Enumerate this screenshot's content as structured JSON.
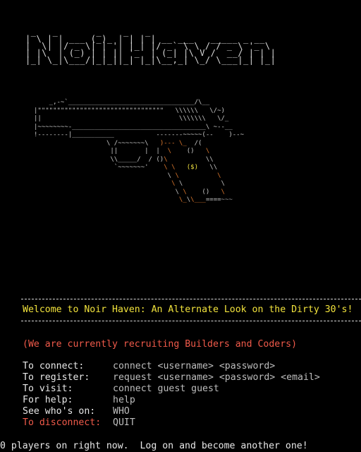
{
  "logo_ascii": " _   _        _____    _    _\n| \\ | |      / ___ \\  | |  | |\n|  \\| | ___ | |   | | | |__| | __ ___   _____ _ __\n| . ` |/ _ \\| |   | | |  __  |/ _` \\ \\ / / _ \\ '_ \\\n| |\\  | (_) | |___| | | |  | | (_| |\\ V /  __/ | | |\n|_| \\_|\\___/ \\_____/  |_|  |_|\\__,_| \\_/ \\___|_| |_|",
  "welcome": "Welcome to Noir Haven: An Alternate Look on the Dirty 30's!",
  "recruiting": "(We are currently recruiting Builders and Coders)",
  "commands": [
    {
      "label": "To connect:",
      "value": "connect <username> <password>"
    },
    {
      "label": "To register:",
      "value": "request <username> <password> <email>"
    },
    {
      "label": "To visit:",
      "value": "connect guest guest"
    },
    {
      "label": "For help:",
      "value": "help"
    },
    {
      "label": "See who's on:",
      "value": "WHO"
    },
    {
      "label": "To disconnect:",
      "value": "QUIT"
    }
  ],
  "footer": "0 players on right now.  Log on and become another one!",
  "colors": {
    "background": "#000000",
    "welcome": "#f2e33c",
    "alert": "#f05a4a",
    "orange_accent": "#e07a2e",
    "text": "#e8e8e8"
  }
}
